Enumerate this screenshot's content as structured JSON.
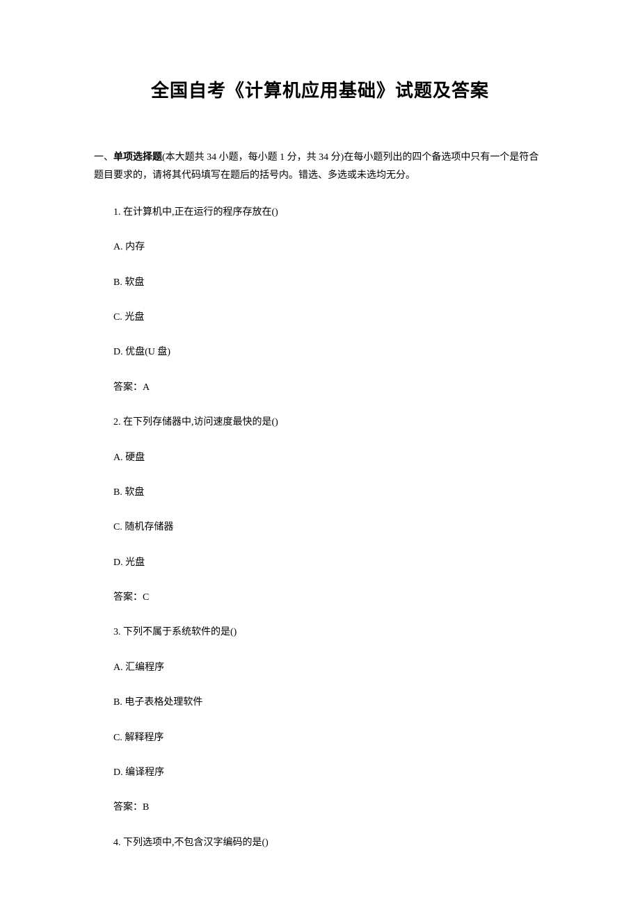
{
  "title": "全国自考《计算机应用基础》试题及答案",
  "section": {
    "prefix": "一、",
    "name": "单项选择题",
    "desc": "(本大题共 34 小题，每小题 1 分，共 34 分)在每小题列出的四个备选项中只有一个是符合题目要求的，请将其代码填写在题后的括号内。错选、多选或未选均无分。"
  },
  "q1": {
    "stem": "1.  在计算机中,正在运行的程序存放在()",
    "a": "A.  内存",
    "b": "B.  软盘",
    "c": "C.  光盘",
    "d": "D.  优盘(U 盘)",
    "ans": "答案：A"
  },
  "q2": {
    "stem": "2.  在下列存储器中,访问速度最快的是()",
    "a": "A.  硬盘",
    "b": "B.  软盘",
    "c": "C.  随机存储器",
    "d": "D.  光盘",
    "ans": "答案：C"
  },
  "q3": {
    "stem": "3.  下列不属于系统软件的是()",
    "a": "A.  汇编程序",
    "b": "B.  电子表格处理软件",
    "c": "C.  解释程序",
    "d": "D.  编译程序",
    "ans": "答案：B"
  },
  "q4": {
    "stem": "4.  下列选项中,不包含汉字编码的是()"
  }
}
